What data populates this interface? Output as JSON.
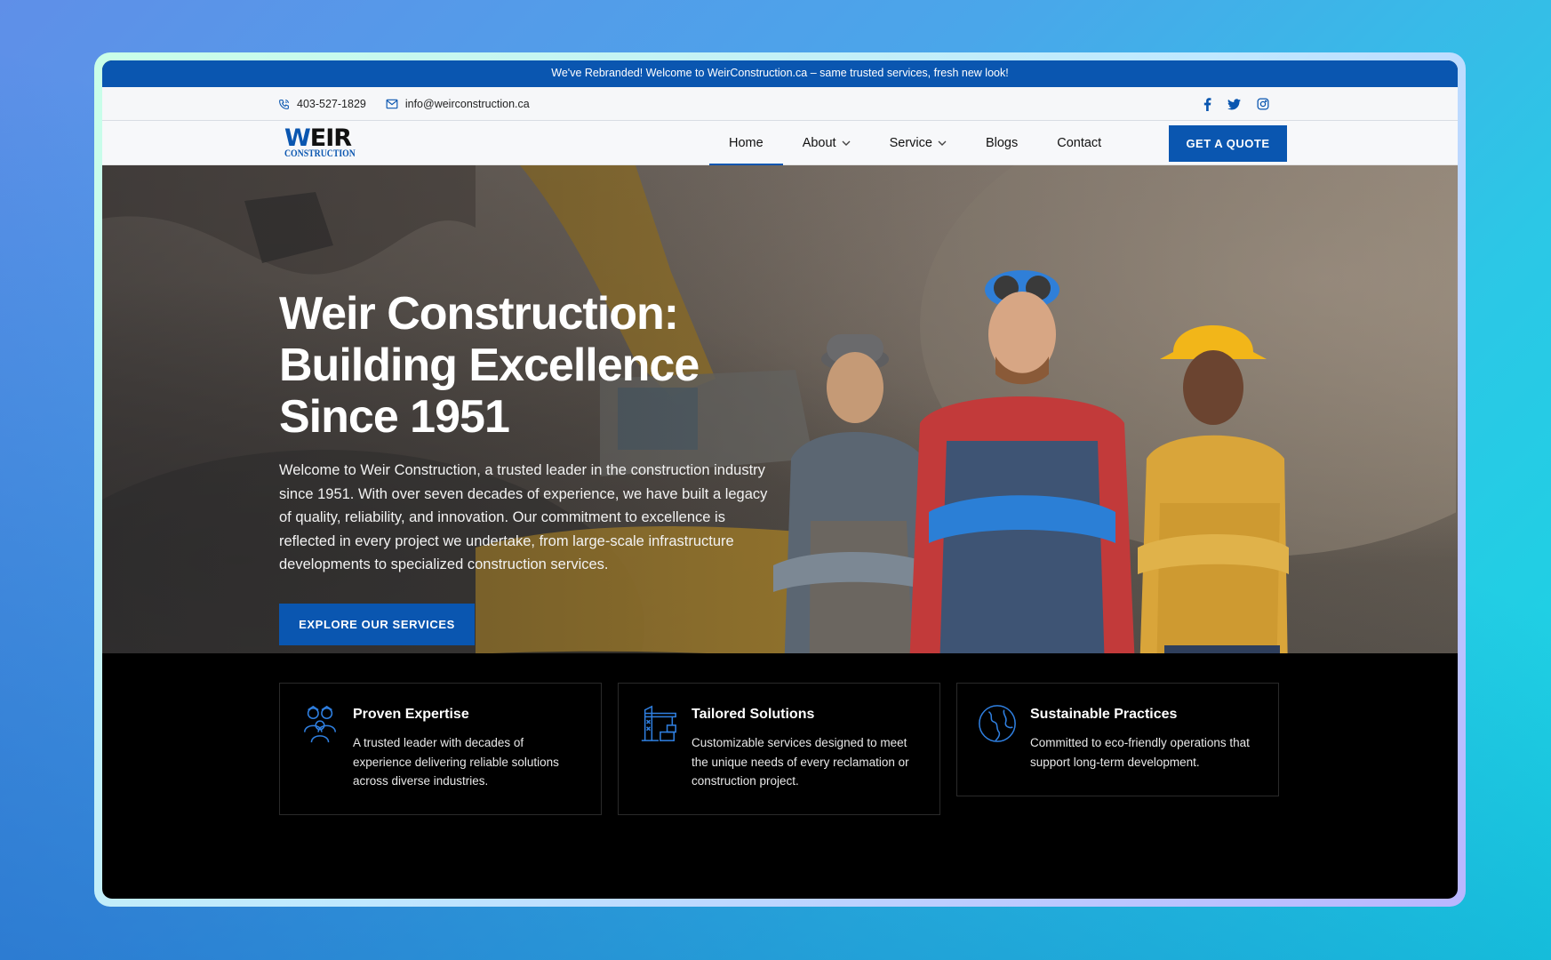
{
  "announcement": "We've Rebranded! Welcome to WeirConstruction.ca – same trusted services, fresh new look!",
  "topbar": {
    "phone": "403-527-1829",
    "email": "info@weirconstruction.ca",
    "social": [
      "facebook-icon",
      "twitter-icon",
      "instagram-icon"
    ]
  },
  "logo": {
    "line1_accent": "W",
    "line1_rest": "EIR",
    "line2": "CONSTRUCTION"
  },
  "nav": {
    "items": [
      {
        "label": "Home",
        "active": true,
        "dropdown": false
      },
      {
        "label": "About",
        "active": false,
        "dropdown": true
      },
      {
        "label": "Service",
        "active": false,
        "dropdown": true
      },
      {
        "label": "Blogs",
        "active": false,
        "dropdown": false
      },
      {
        "label": "Contact",
        "active": false,
        "dropdown": false
      }
    ],
    "cta": "GET A QUOTE"
  },
  "hero": {
    "title_line1": "Weir Construction:",
    "title_line2": "Building Excellence",
    "title_line3": "Since 1951",
    "description": "Welcome to Weir Construction, a trusted leader in the construction industry since 1951. With over seven decades of experience, we have built a legacy of quality, reliability, and innovation. Our commitment to excellence is reflected in every project we undertake, from large-scale infrastructure developments to specialized construction services.",
    "cta": "EXPLORE OUR SERVICES"
  },
  "features": [
    {
      "icon": "team-icon",
      "title": "Proven Expertise",
      "text": "A trusted leader with decades of experience delivering reliable solutions across diverse industries."
    },
    {
      "icon": "crane-icon",
      "title": "Tailored Solutions",
      "text": "Customizable services designed to meet the unique needs of every reclamation or construction project."
    },
    {
      "icon": "globe-icon",
      "title": "Sustainable Practices",
      "text": "Committed to eco-friendly operations that support long-term development."
    }
  ],
  "colors": {
    "brand_blue": "#0a56b0",
    "dark": "#000000"
  }
}
